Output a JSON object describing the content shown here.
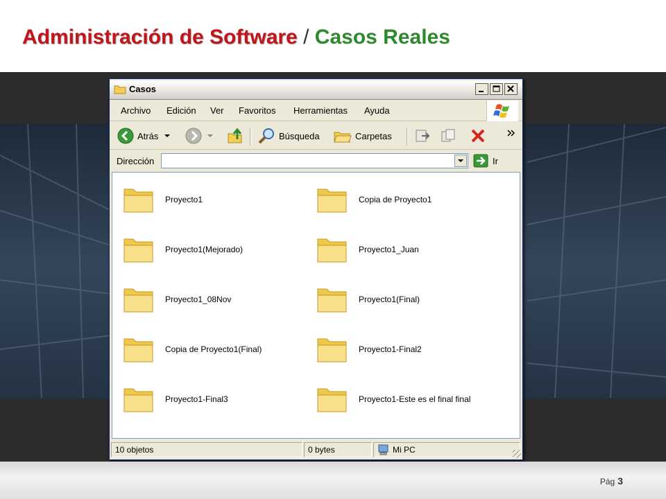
{
  "slide": {
    "title_main": "Administración de Software",
    "title_sep": "/",
    "title_sub": "Casos Reales",
    "page_label": "Pág",
    "page_number": "3"
  },
  "window": {
    "title": "Casos",
    "menu": [
      "Archivo",
      "Edición",
      "Ver",
      "Favoritos",
      "Herramientas",
      "Ayuda"
    ],
    "toolbar": {
      "back": "Atrás",
      "search": "Búsqueda",
      "folders": "Carpetas"
    },
    "address": {
      "label": "Dirección",
      "value": "",
      "go": "Ir"
    },
    "folders": [
      "Proyecto1",
      "Copia de Proyecto1",
      "Proyecto1(Mejorado)",
      "Proyecto1_Juan",
      "Proyecto1_08Nov",
      "Proyecto1(Final)",
      "Copia de Proyecto1(Final)",
      "Proyecto1-Final2",
      "Proyecto1-Final3",
      "Proyecto1-Este es el final final"
    ],
    "status": {
      "count": "10 objetos",
      "size": "0 bytes",
      "location": "Mi PC"
    }
  },
  "colors": {
    "title_main": "#c0161b",
    "title_sub": "#2c8a2c",
    "folder_fill": "#f7d96b"
  }
}
